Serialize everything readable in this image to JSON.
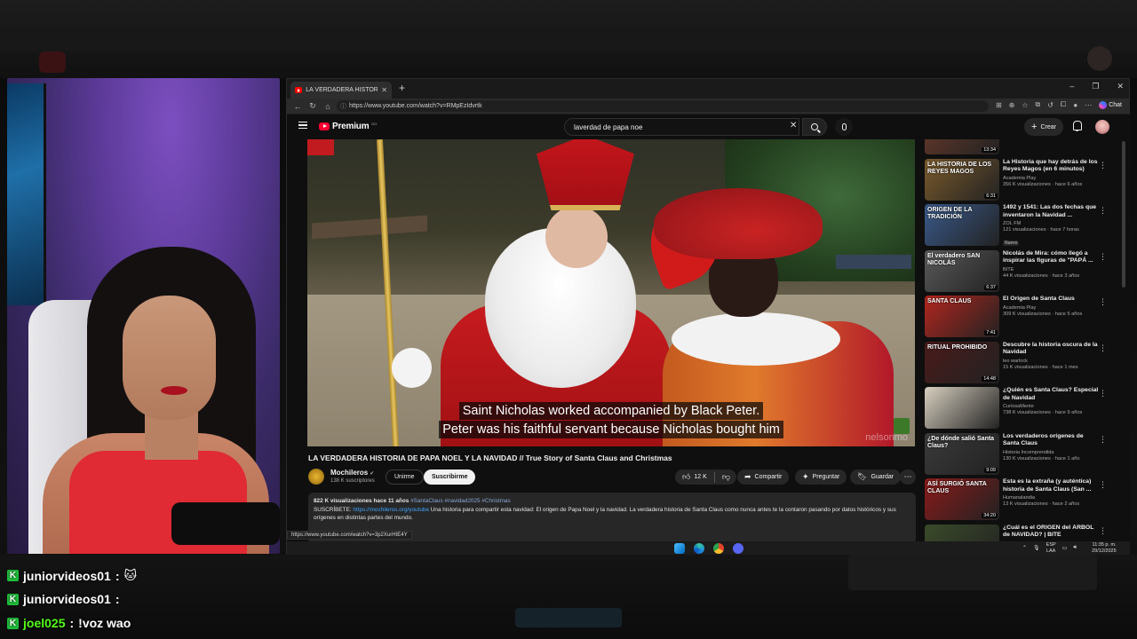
{
  "browser": {
    "tab_title": "LA VERDADERA HISTORIA DE PAPA NOEL",
    "url": "https://www.youtube.com/watch?v=RMpEzIdvrtk",
    "chat_label": "Chat"
  },
  "youtube": {
    "logo_text": "Premium",
    "logo_sup": "DO",
    "search_value": "laverdad de papa noe",
    "create_label": "Crear"
  },
  "video": {
    "subtitle_line1": "Saint Nicholas worked accompanied by Black Peter.",
    "subtitle_line2": "Peter was his faithful servant because Nicholas bought him",
    "watermark": "nelsonmo",
    "title": "LA VERDADERA HISTORIA DE PAPA NOEL Y LA NAVIDAD // True Story of Santa Claus and Christmas",
    "channel_name": "Mochileros",
    "channel_subs": "138 K suscriptores",
    "join_label": "Unirme",
    "subscribe_label": "Suscribirme",
    "likes": "12 K",
    "share_label": "Compartir",
    "ask_label": "Preguntar",
    "save_label": "Guardar",
    "desc_meta": "822 K visualizaciones  hace 11 años",
    "desc_tags": "#SantaClaus #navidad2025 #Christmas",
    "desc_prefix": "SUSCRÍBETE:",
    "desc_link": "https://mochileros.org/youtube",
    "desc_text": "Una historia para compartir esta navidad: El origen de Papa Noel y la navidad. La verdadera historia de Santa Claus como nunca antes te la contaron pasando por datos históricos y sus orígenes en distintas partes del mundo.",
    "status_url": "https://www.youtube.com/watch?v=3p2XurHtE4Y"
  },
  "recommendations": [
    {
      "thumb_text": "",
      "duration": "13:34",
      "title": "",
      "channel": "",
      "stats": "",
      "badge": ""
    },
    {
      "thumb_text": "LA HISTORIA DE LOS REYES MAGOS",
      "duration": "6:31",
      "title": "La Historia que hay detrás de los Reyes Magos (en 6 minutos)",
      "channel": "Academia Play",
      "stats": "356 K visualizaciones · hace 6 años",
      "badge": ""
    },
    {
      "thumb_text": "ORIGEN DE LA TRADICIÓN",
      "duration": "",
      "title": "1492 y 1541: Las dos fechas que inventaron la Navidad ...",
      "channel": "ZOL FM",
      "stats": "121 visualizaciones · hace 7 horas",
      "badge": "Nuevo"
    },
    {
      "thumb_text": "El verdadero SAN NICOLÁS",
      "duration": "6:37",
      "title": "Nicolás de Mira: cómo llegó a inspirar las figuras de \"PAPÁ ...",
      "channel": "BITE",
      "stats": "44 K visualizaciones · hace 3 años",
      "badge": ""
    },
    {
      "thumb_text": "SANTA CLAUS",
      "duration": "7:41",
      "title": "El Origen de Santa Claus",
      "channel": "Academia Play",
      "stats": "309 K visualizaciones · hace 5 años",
      "badge": ""
    },
    {
      "thumb_text": "RITUAL PROHIBIDO",
      "duration": "14:48",
      "title": "Descubre la historia oscura de la Navidad",
      "channel": "leo warlock",
      "stats": "15 K visualizaciones · hace 1 mes",
      "badge": ""
    },
    {
      "thumb_text": "",
      "duration": "",
      "title": "¿Quién es Santa Claus? Especial de Navidad",
      "channel": "CuriosaMente",
      "stats": "738 K visualizaciones · hace 9 años",
      "badge": ""
    },
    {
      "thumb_text": "¿De dónde salió Santa Claus?",
      "duration": "9:09",
      "title": "Los verdaderos orígenes de Santa Claus",
      "channel": "Historia Incomprendida",
      "stats": "130 K visualizaciones · hace 1 año",
      "badge": ""
    },
    {
      "thumb_text": "ASÍ SURGIÓ SANTA CLAUS",
      "duration": "34:20",
      "title": "Esta es la extraña (y auténtica) historia de Santa Claus (San ...",
      "channel": "Humanalandia",
      "stats": "13 K visualizaciones · hace 2 años",
      "badge": ""
    },
    {
      "thumb_text": "",
      "duration": "",
      "title": "¿Cuál es el ORIGEN del ÁRBOL de NAVIDAD? | BITE",
      "channel": "",
      "stats": "",
      "badge": ""
    }
  ],
  "taskbar": {
    "lang_top": "ESP",
    "lang_bottom": "LAA",
    "time": "11:35 p. m.",
    "date": "29/12/2025"
  },
  "chat": [
    {
      "user": "juniorvideos01",
      "message": "🐱",
      "green": false
    },
    {
      "user": "juniorvideos01",
      "message": "",
      "green": false
    },
    {
      "user": "joel025",
      "message": "!voz wao",
      "green": true
    }
  ],
  "colors": {
    "accent_red": "#ff0033",
    "chat_green": "#53fc18",
    "kick_badge": "#1fbd3a"
  }
}
